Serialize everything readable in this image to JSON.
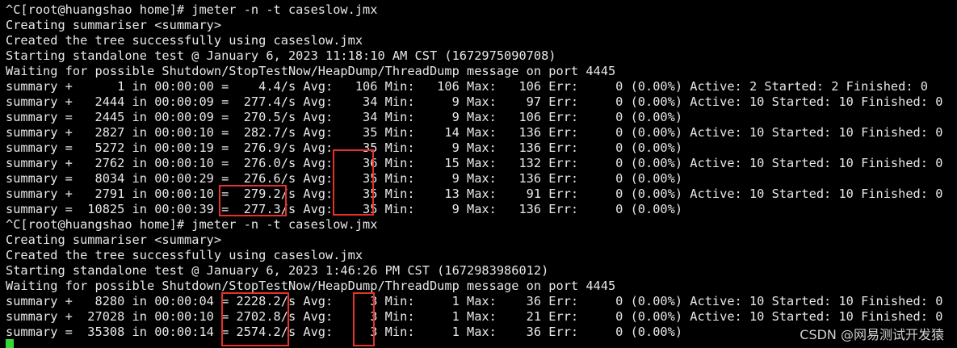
{
  "terminal": {
    "lines": [
      "^C[root@huangshao home]# jmeter -n -t caseslow.jmx",
      "Creating summariser <summary>",
      "Created the tree successfully using caseslow.jmx",
      "Starting standalone test @ January 6, 2023 11:18:10 AM CST (1672975090708)",
      "Waiting for possible Shutdown/StopTestNow/HeapDump/ThreadDump message on port 4445",
      "summary +      1 in 00:00:00 =    4.4/s Avg:   106 Min:   106 Max:   106 Err:     0 (0.00%) Active: 2 Started: 2 Finished: 0",
      "summary +   2444 in 00:00:09 =  277.4/s Avg:    34 Min:     9 Max:    97 Err:     0 (0.00%) Active: 10 Started: 10 Finished: 0",
      "summary =   2445 in 00:00:09 =  270.5/s Avg:    34 Min:     9 Max:   106 Err:     0 (0.00%)",
      "summary +   2827 in 00:00:10 =  282.7/s Avg:    35 Min:    14 Max:   136 Err:     0 (0.00%) Active: 10 Started: 10 Finished: 0",
      "summary =   5272 in 00:00:19 =  276.9/s Avg:    35 Min:     9 Max:   136 Err:     0 (0.00%)",
      "summary +   2762 in 00:00:10 =  276.0/s Avg:    36 Min:    15 Max:   132 Err:     0 (0.00%) Active: 10 Started: 10 Finished: 0",
      "summary =   8034 in 00:00:29 =  276.6/s Avg:    35 Min:     9 Max:   136 Err:     0 (0.00%)",
      "summary +   2791 in 00:00:10 =  279.2/s Avg:    35 Min:    13 Max:    91 Err:     0 (0.00%) Active: 10 Started: 10 Finished: 0",
      "summary =  10825 in 00:00:39 =  277.3/s Avg:    35 Min:     9 Max:   136 Err:     0 (0.00%)",
      "^C[root@huangshao home]# jmeter -n -t caseslow.jmx",
      "Creating summariser <summary>",
      "Created the tree successfully using caseslow.jmx",
      "Starting standalone test @ January 6, 2023 1:46:26 PM CST (1672983986012)",
      "Waiting for possible Shutdown/StopTestNow/HeapDump/ThreadDump message on port 4445",
      "summary +   8280 in 00:00:04 = 2228.2/s Avg:     3 Min:     1 Max:    36 Err:     0 (0.00%) Active: 10 Started: 10 Finished: 0",
      "summary +  27028 in 00:00:10 = 2702.8/s Avg:     3 Min:     1 Max:    21 Err:     0 (0.00%) Active: 10 Started: 10 Finished: 0",
      "summary =  35308 in 00:00:14 = 2574.2/s Avg:     3 Min:     1 Max:    36 Err:     0 (0.00%)"
    ]
  },
  "watermark": "CSDN @网易测试开发猿",
  "colors": {
    "background": "#000000",
    "text": "#e8e8e8",
    "highlight_box": "#e8302b",
    "cursor": "#35d935"
  }
}
